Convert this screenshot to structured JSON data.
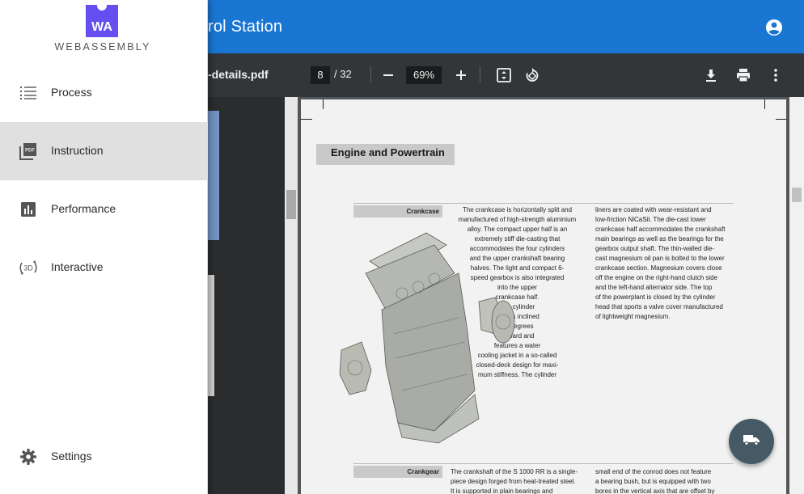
{
  "appbar": {
    "title": "rol Station",
    "account_icon": "account-circle-icon"
  },
  "pdf_toolbar": {
    "filename": "-details.pdf",
    "current_page": "8",
    "total_pages": "/ 32",
    "zoom": "69%"
  },
  "page": {
    "heading": "Engine and Powertrain",
    "sections": [
      {
        "label": "Crankcase",
        "col1": [
          "The crankcase is horizontally split and",
          "manufactured of high-strength aluminium",
          "alloy. The compact upper half is an",
          "extremely stiff die-casting that",
          "accommodates the four cylinders",
          "and the upper crankshaft bearing",
          "halves. The light and compact 6-",
          "speed gearbox is also integrated",
          "into the upper",
          "crankcase half.",
          "The cylinder",
          "bank is inclined",
          "32 degrees",
          "forward and",
          "features a water",
          "cooling jacket in a so-called",
          "closed-deck design for maxi-",
          "mum stiffness. The cylinder"
        ],
        "col2": [
          "liners are coated with wear-resistant and",
          "low-friction NiCaSil. The die-cast lower",
          "crankcase half accommodates the crankshaft",
          "main bearings as well as the bearings for the",
          "gearbox output shaft. The thin-walled die-",
          "cast magnesium oil pan is bolted to the lower",
          "crankcase section. Magnesium covers close",
          "off the engine on the right-hand clutch side",
          "and the left-hand alternator side. The top",
          "of the powerplant is closed by the cylinder",
          "head that sports a valve cover manufactured",
          "of lightweight magnesium."
        ]
      },
      {
        "label": "Crankgear",
        "col1": [
          "The crankshaft of the S 1000 RR is a single-",
          "piece design forged from heat-treated steel.",
          "It is supported in plain bearings and"
        ],
        "col2": [
          "small end of the conrod does not feature",
          "a bearing bush, but is equipped with two",
          "bores in the vertical axis that are offset by"
        ]
      }
    ]
  },
  "drawer": {
    "logo_letters": "WA",
    "logo_text": "WEBASSEMBLY",
    "items": [
      {
        "label": "Process",
        "icon": "list-icon"
      },
      {
        "label": "Instruction",
        "icon": "pdf-icon"
      },
      {
        "label": "Performance",
        "icon": "bar-chart-icon"
      },
      {
        "label": "Interactive",
        "icon": "3d-rotation-icon"
      }
    ],
    "settings": {
      "label": "Settings",
      "icon": "gear-icon"
    }
  },
  "fab": {
    "icon": "truck-icon"
  }
}
